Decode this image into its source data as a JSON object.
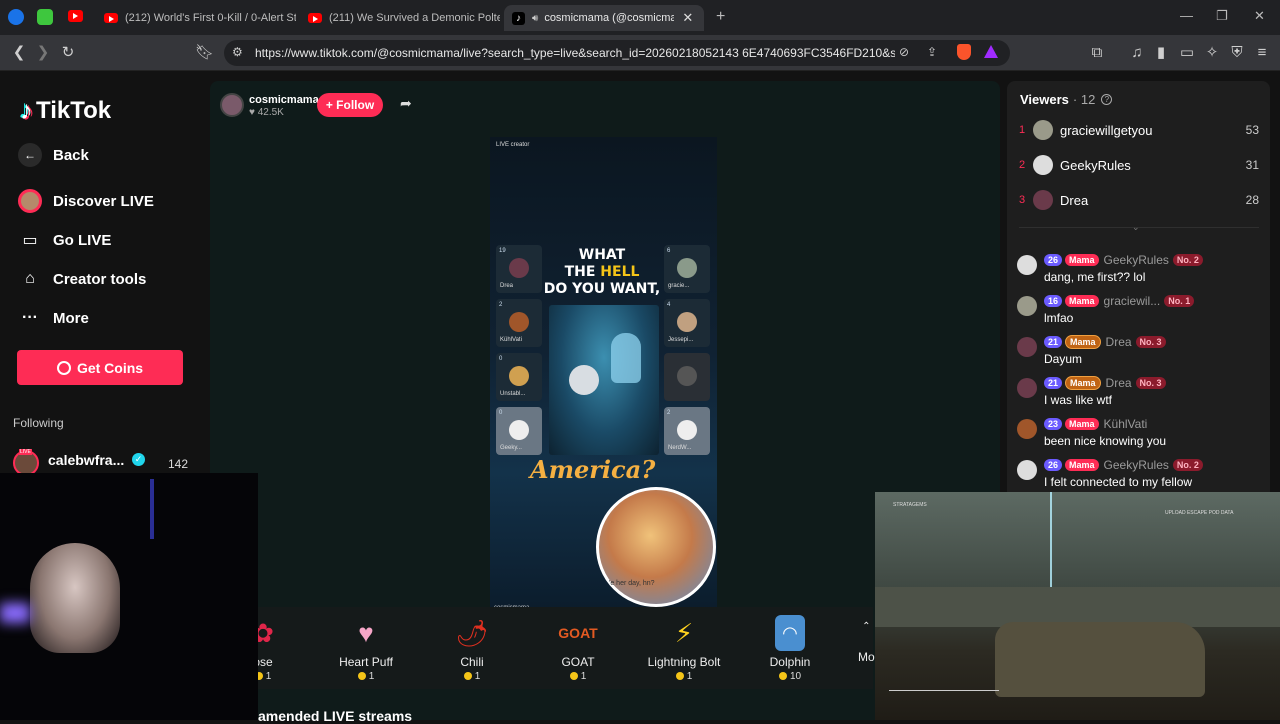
{
  "browser": {
    "tabs": [
      {
        "title": "(212) World's First 0-Kill / 0-Alert Ste"
      },
      {
        "title": "(211) We Survived a Demonic Polterg"
      },
      {
        "title": "cosmicmama (@cosmicmama"
      }
    ],
    "url": "https://www.tiktok.com/@cosmicmama/live?search_type=live&search_id=20260218052143 6E4740693FC3546FD210&sear..."
  },
  "sidebar": {
    "logo": "TikTok",
    "back": "Back",
    "items": [
      {
        "label": "Discover LIVE"
      },
      {
        "label": "Go LIVE"
      },
      {
        "label": "Creator tools"
      },
      {
        "label": "More"
      }
    ],
    "get_coins": "Get Coins",
    "following_heading": "Following",
    "following": [
      {
        "name": "calebwfra...",
        "count": "142",
        "badge": "LIVE"
      }
    ]
  },
  "stream": {
    "host_name": "cosmicmama",
    "host_likes": "42.5K",
    "follow_label": "+ Follow",
    "video_label_top": "LIVE creator",
    "overlay_text_1": "WHAT",
    "overlay_text_2a": "THE",
    "overlay_text_2b": "HELL",
    "overlay_text_3": "DO YOU WANT,",
    "overlay_text_4": "America?",
    "bubble_text": "'e her day, hn?",
    "watermark": "cosmicmama",
    "slots": [
      {
        "count": "19",
        "name": "Drea"
      },
      {
        "count": "6",
        "name": "gracie..."
      },
      {
        "count": "2",
        "name": "KühlVati"
      },
      {
        "count": "4",
        "name": "Jessepi..."
      },
      {
        "count": "0",
        "name": "Unstabl..."
      },
      {
        "count": "0",
        "name": "Geeky..."
      },
      {
        "count": "2",
        "name": "NerdW..."
      }
    ]
  },
  "gifts": [
    {
      "name": "ose",
      "cost": "1"
    },
    {
      "name": "Heart Puff",
      "cost": "1"
    },
    {
      "name": "Chili",
      "cost": "1"
    },
    {
      "name": "GOAT",
      "cost": "1"
    },
    {
      "name": "Lightning Bolt",
      "cost": "1"
    },
    {
      "name": "Dolphin",
      "cost": "10"
    }
  ],
  "gifts_more": "Mo",
  "recommended": "amended LIVE streams",
  "viewers": {
    "title": "Viewers",
    "count": "· 12",
    "list": [
      {
        "rank": "1",
        "name": "graciewillgetyou",
        "score": "53"
      },
      {
        "rank": "2",
        "name": "GeekyRules",
        "score": "31"
      },
      {
        "rank": "3",
        "name": "Drea",
        "score": "28"
      }
    ]
  },
  "chat": [
    {
      "level": "26",
      "fan": "Mama",
      "name": "GeekyRules",
      "rank": "No. 2",
      "msg": "dang, me first?? lol"
    },
    {
      "level": "16",
      "fan": "Mama",
      "name": "graciewil...",
      "rank": "No. 1",
      "msg": "lmfao"
    },
    {
      "level": "21",
      "fan": "Mama",
      "name": "Drea",
      "rank": "No. 3",
      "msg": "Dayum"
    },
    {
      "level": "21",
      "fan": "Mama",
      "name": "Drea",
      "rank": "No. 3",
      "msg": "I was like wtf"
    },
    {
      "level": "23",
      "fan": "Mama",
      "name": "KühlVati",
      "rank": "",
      "msg": "been nice knowing you"
    },
    {
      "level": "26",
      "fan": "Mama",
      "name": "GeekyRules",
      "rank": "No. 2",
      "msg": "I felt connected to my fellow"
    }
  ],
  "game": {
    "hud_top_left": "STRATAGEMS",
    "hud_top_right": "UPLOAD ESCAPE POD DATA"
  },
  "colors": {
    "accent": "#fe2c55",
    "background": "#121212",
    "panel": "#1e1e1e"
  }
}
